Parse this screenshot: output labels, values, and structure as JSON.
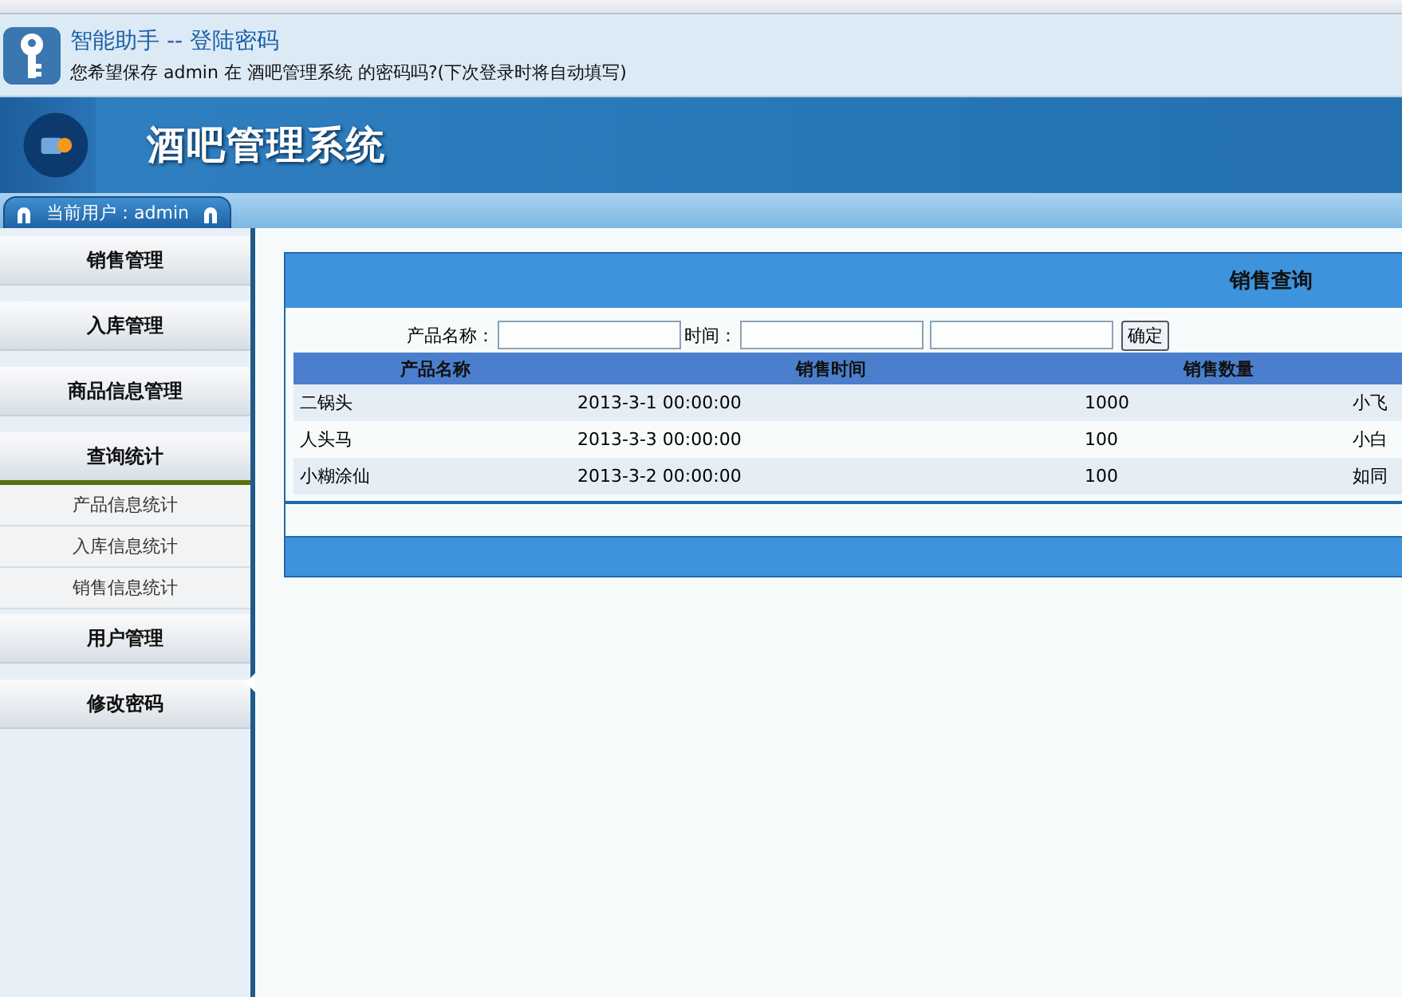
{
  "password_bar": {
    "title": "智能助手 -- 登陆密码",
    "message": "您希望保存 admin 在 酒吧管理系统 的密码吗?(下次登录时将自动填写)"
  },
  "header": {
    "title": "酒吧管理系统"
  },
  "user_bar": {
    "label": "当前用户：admin"
  },
  "sidebar": {
    "items": [
      {
        "label": "销售管理",
        "expanded": false
      },
      {
        "label": "入库管理",
        "expanded": false
      },
      {
        "label": "商品信息管理",
        "expanded": false
      },
      {
        "label": "查询统计",
        "expanded": true,
        "children": [
          {
            "label": "产品信息统计"
          },
          {
            "label": "入库信息统计"
          },
          {
            "label": "销售信息统计"
          }
        ]
      },
      {
        "label": "用户管理",
        "expanded": false
      },
      {
        "label": "修改密码",
        "expanded": false
      }
    ]
  },
  "panel": {
    "title": "销售查询",
    "filter": {
      "name_label": "产品名称：",
      "time_label": "时间：",
      "button": "确定"
    },
    "table": {
      "columns": [
        "产品名称",
        "销售时间",
        "销售数量"
      ],
      "rows": [
        [
          "二锅头",
          "2013-3-1 00:00:00",
          "1000",
          "小飞"
        ],
        [
          "人头马",
          "2013-3-3 00:00:00",
          "100",
          "小白"
        ],
        [
          "小糊涂仙",
          "2013-3-2 00:00:00",
          "100",
          "如同"
        ]
      ]
    }
  }
}
